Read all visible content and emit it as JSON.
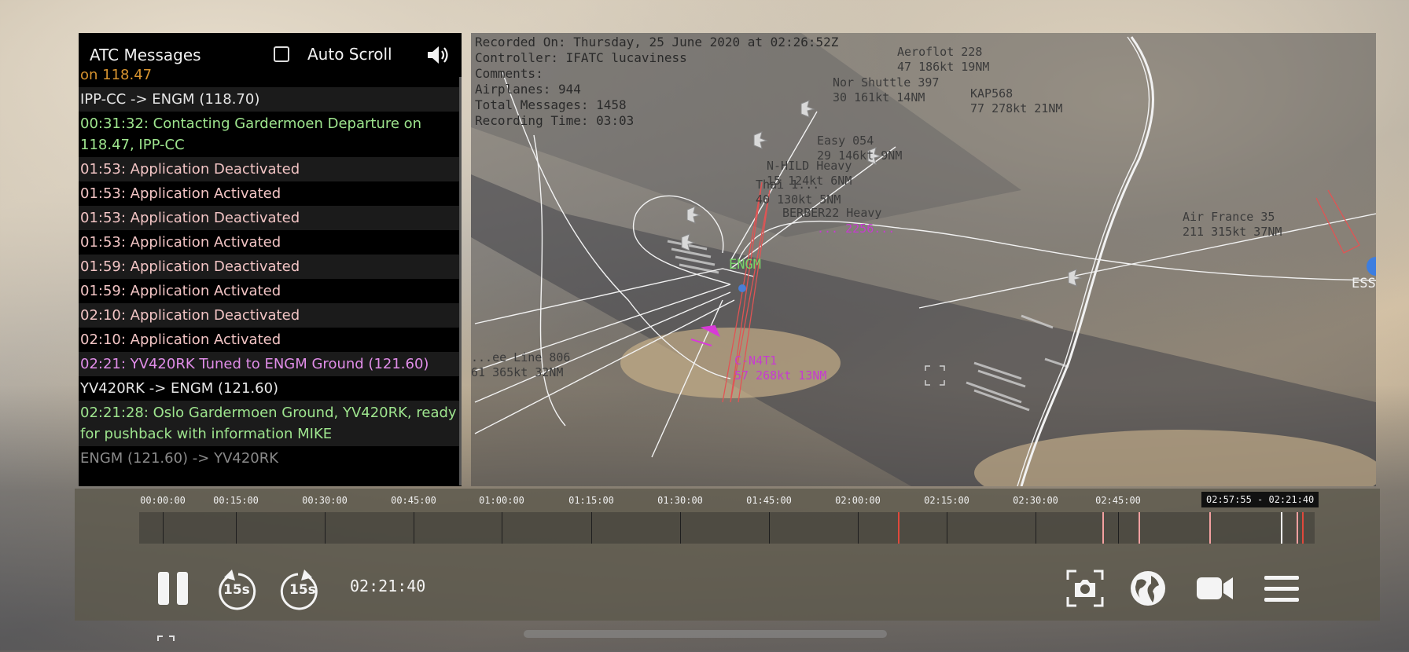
{
  "atc": {
    "title": "ATC Messages",
    "autoscroll_label": "Auto Scroll",
    "messages": [
      {
        "text": "on 118.47",
        "color": "orange"
      },
      {
        "text": "IPP-CC -> ENGM (118.70)",
        "color": "white"
      },
      {
        "text": "00:31:32: Contacting Gardermoen Departure on 118.47, IPP-CC",
        "color": "green"
      },
      {
        "text": "01:53: Application Deactivated",
        "color": "pink"
      },
      {
        "text": "01:53: Application Activated",
        "color": "pink"
      },
      {
        "text": "01:53: Application Deactivated",
        "color": "pink"
      },
      {
        "text": "01:53: Application Activated",
        "color": "pink"
      },
      {
        "text": "01:59: Application Deactivated",
        "color": "pink"
      },
      {
        "text": "01:59: Application Activated",
        "color": "pink"
      },
      {
        "text": "02:10: Application Deactivated",
        "color": "pink"
      },
      {
        "text": "02:10: Application Activated",
        "color": "pink"
      },
      {
        "text": "02:21: YV420RK Tuned to ENGM Ground (121.60)",
        "color": "violet"
      },
      {
        "text": "YV420RK -> ENGM (121.60)",
        "color": "white"
      },
      {
        "text": "02:21:28: Oslo Gardermoen Ground, YV420RK, ready for pushback with information MIKE",
        "color": "green"
      },
      {
        "text": "ENGM (121.60) -> YV420RK",
        "color": "grey"
      }
    ]
  },
  "map": {
    "info": {
      "recorded_on": "Recorded On: Thursday, 25 June 2020 at 02:26:52Z",
      "controller": "Controller: IFATC lucaviness",
      "comments": "Comments:",
      "airplanes": "Airplanes: 944",
      "total_messages": "Total Messages: 1458",
      "recording_time": "Recording Time: 03:03"
    },
    "flights": [
      {
        "line1": "Aeroflot 228",
        "line2": "47 186kt 19NM",
        "style": "dark"
      },
      {
        "line1": "Nor Shuttle 397",
        "line2": "30 161kt 14NM",
        "style": "dark"
      },
      {
        "line1": "KAP568",
        "line2": "77 278kt 21NM",
        "style": "dark"
      },
      {
        "line1": "Easy 054",
        "line2": "29 146kt 9NM",
        "style": "dark"
      },
      {
        "line1": "N-HILD Heavy",
        "line2": "15 124kt 6NM",
        "style": "dark"
      },
      {
        "line1": "Thai 1...",
        "line2": "40 130kt 5NM",
        "style": "dark"
      },
      {
        "line1": "BERBER22 Heavy",
        "line2": "",
        "style": "dark"
      },
      {
        "line1": "... 2256...",
        "line2": "",
        "style": "magenta"
      },
      {
        "line1": "Air France 35",
        "line2": "211 315kt 37NM",
        "style": "dark"
      },
      {
        "line1": "ENGM",
        "line2": "",
        "style": "green"
      },
      {
        "line1": "...ee Line 806",
        "line2": "61 365kt 32NM",
        "style": "dark"
      },
      {
        "line1": "C-N4T1",
        "line2": "57 268kt 13NM",
        "style": "magenta"
      },
      {
        "line1": "ESS",
        "line2": "",
        "style": "white"
      }
    ]
  },
  "timeline": {
    "ticks": [
      "00:00:00",
      "00:15:00",
      "00:30:00",
      "00:45:00",
      "01:00:00",
      "01:15:00",
      "01:30:00",
      "01:45:00",
      "02:00:00",
      "02:15:00",
      "02:30:00",
      "02:45:00"
    ],
    "cursor_label": "02:57:55 - 02:21:40",
    "current_time": "02:21:40",
    "skip_back_label": "15s",
    "skip_forward_label": "15s",
    "marker_color_red": "#e0483b",
    "marker_color_pink": "#f4a0a0"
  },
  "controls": {
    "pause": "pause-icon",
    "rewind": "rewind-15-icon",
    "forward": "forward-15-icon",
    "screenshot": "camera-screenshot-icon",
    "globe": "globe-icon",
    "video": "video-camera-icon",
    "menu": "hamburger-menu-icon"
  }
}
